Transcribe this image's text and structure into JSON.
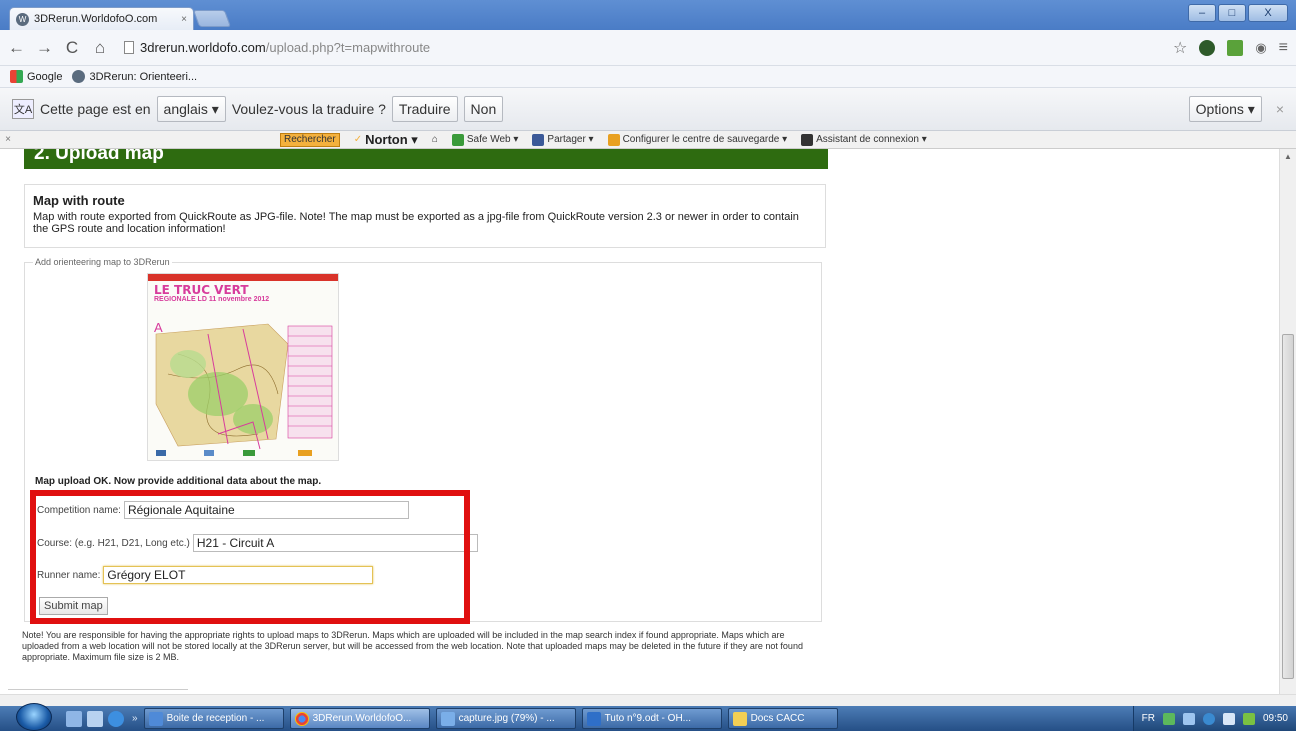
{
  "browser": {
    "tab_title": "3DRerun.WorldofoO.com",
    "tab_close": "×",
    "window_min": "–",
    "window_max": "□",
    "window_close": "X",
    "url_host": "3drerun.worldofo.com",
    "url_path": "/upload.php?t=mapwithroute"
  },
  "bookmarks": [
    {
      "label": "Google"
    },
    {
      "label": "3DRerun: Orienteeri..."
    }
  ],
  "translate_bar": {
    "prefix": "Cette page est en",
    "language": "anglais ▾",
    "question": "Voulez-vous la traduire ?",
    "translate": "Traduire",
    "no": "Non",
    "options": "Options ▾",
    "close": "×"
  },
  "norton": {
    "close": "×",
    "search": "Rechercher",
    "brand": "Norton ▾",
    "safe_web": "Safe Web ▾",
    "share": "Partager ▾",
    "backup": "Configurer le centre de sauvegarde ▾",
    "login": "Assistant de connexion ▾"
  },
  "page": {
    "section_title": "2. Upload map",
    "info_title": "Map with route",
    "info_text": "Map with route exported from QuickRoute as JPG-file. Note! The map must be exported as a jpg-file from QuickRoute version 2.3 or newer in order to contain the GPS route and location information!",
    "legend": "Add orienteering map to 3DRerun",
    "map_title": "LE TRUC VERT",
    "map_sub": "REGIONALE LD 11 novembre 2012",
    "map_letter": "A",
    "upload_ok": "Map upload OK. Now provide additional data about the map.",
    "competition_label": "Competition name:",
    "competition_value": "Régionale Aquitaine",
    "course_label": "Course: (e.g. H21, D21, Long etc.)",
    "course_value": "H21 - Circuit A",
    "runner_label": "Runner name:",
    "runner_value": "Grégory ELOT",
    "submit": "Submit map",
    "note": "Note! You are responsible for having the appropriate rights to upload maps to 3DRerun. Maps which are uploaded will be included in the map search index if found appropriate. Maps which are uploaded from a web location will not be stored locally at the 3DRerun server, but will be accessed from the web location. Note that uploaded maps may be deleted in the future if they are not found appropriate. Maximum file size is 2 MB."
  },
  "taskbar": {
    "tasks": [
      "Boite de reception - ...",
      "3DRerun.WorldofoO...",
      "capture.jpg (79%) - ...",
      "Tuto n°9.odt - OH...",
      "Docs CACC"
    ],
    "lang": "FR",
    "time": "09:50"
  },
  "colors": {
    "green_header": "#2e6b10",
    "highlight_rect": "#e01010"
  }
}
